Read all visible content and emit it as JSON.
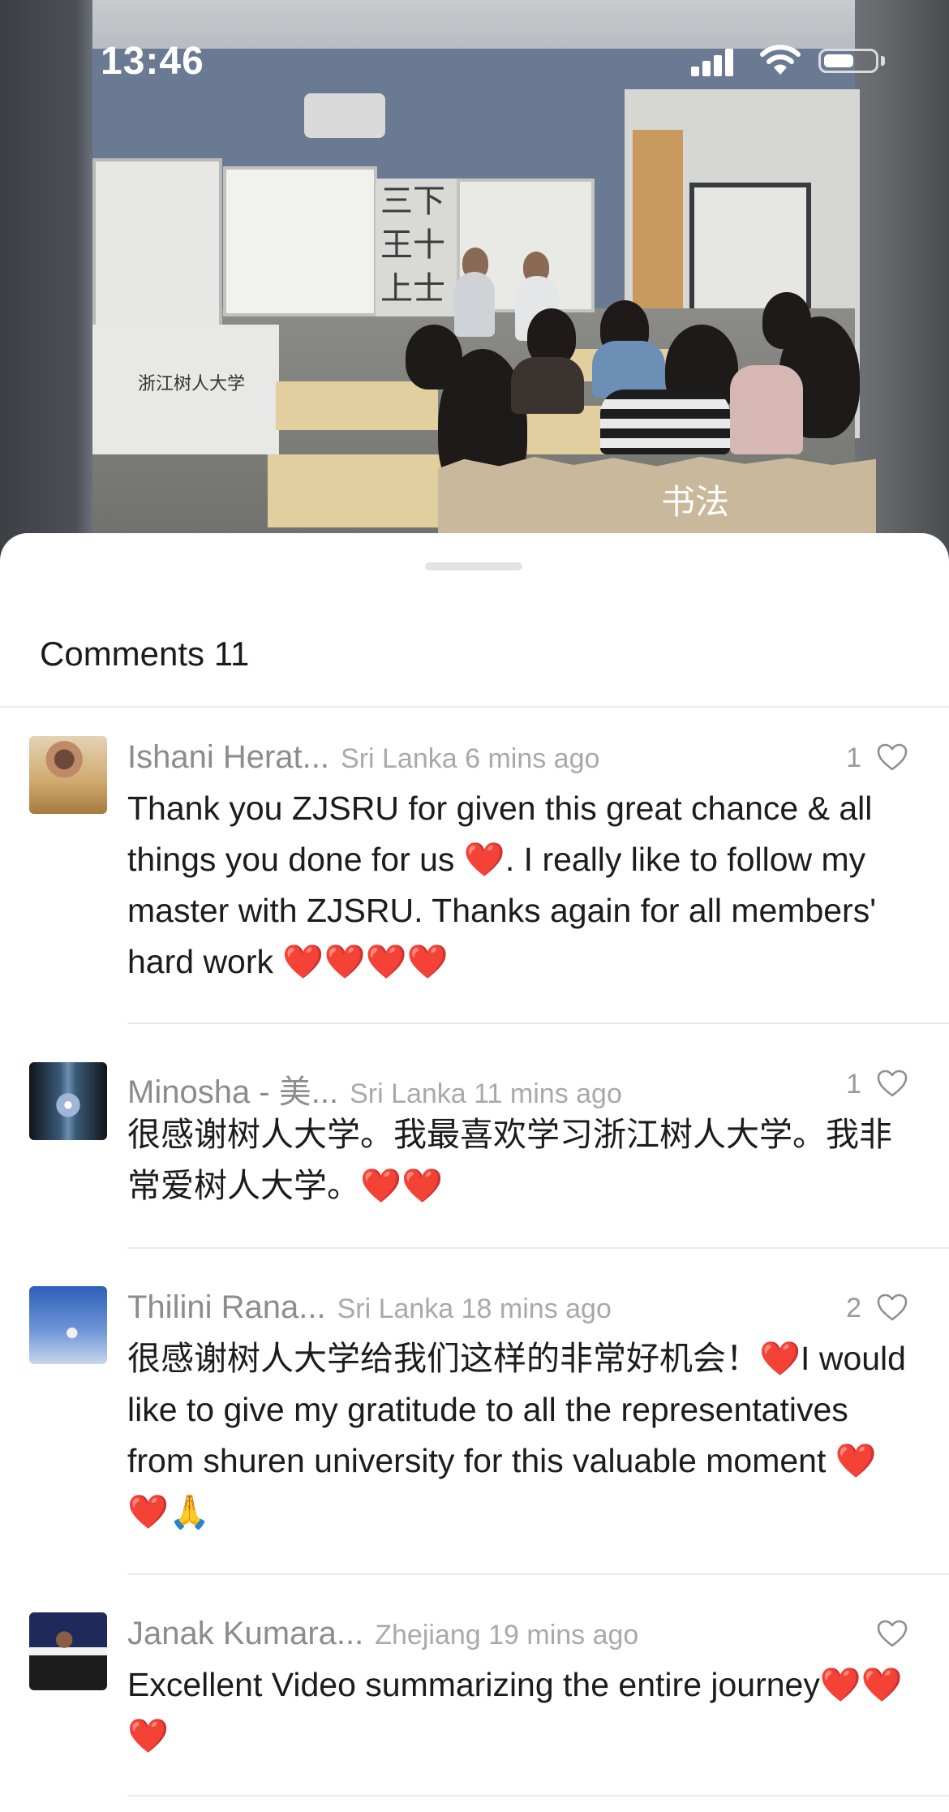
{
  "status_bar": {
    "time": "13:46"
  },
  "media": {
    "overlay_label": "书法",
    "podium_logo": "浙江树人大学"
  },
  "comments_sheet": {
    "title": "Comments 11",
    "comments": [
      {
        "name": "Ishani Herat...",
        "meta": "Sri Lanka 6 mins ago",
        "likes": "1",
        "text": "Thank you ZJSRU for given this great chance & all things you done  for us ❤️. I really like to follow my master with ZJSRU. Thanks again for all members' hard work ❤️❤️❤️❤️"
      },
      {
        "name": "Minosha - 美...",
        "meta": "Sri Lanka 11 mins ago",
        "likes": "1",
        "text": "很感谢树人大学。我最喜欢学习浙江树人大学。我非常爱树人大学。❤️❤️"
      },
      {
        "name": "Thilini Rana...",
        "meta": "Sri Lanka 18 mins ago",
        "likes": "2",
        "text": "很感谢树人大学给我们这样的非常好机会！❤️I would like to give my gratitude to all the representatives from shuren university for this valuable moment ❤️❤️🙏"
      },
      {
        "name": "Janak Kumara...",
        "meta": "Zhejiang 19 mins ago",
        "likes": "",
        "text": "Excellent Video summarizing the entire journey❤️❤️❤️"
      }
    ]
  },
  "icons": {
    "like": "heart-outline-icon",
    "signal": "cellular-signal-icon",
    "wifi": "wifi-icon",
    "battery": "battery-icon"
  },
  "colors": {
    "like_count": "#9a9a9a",
    "name": "#8c8c8c",
    "meta": "#a9a9a9",
    "emoji_heart": "#ef4f6c"
  }
}
